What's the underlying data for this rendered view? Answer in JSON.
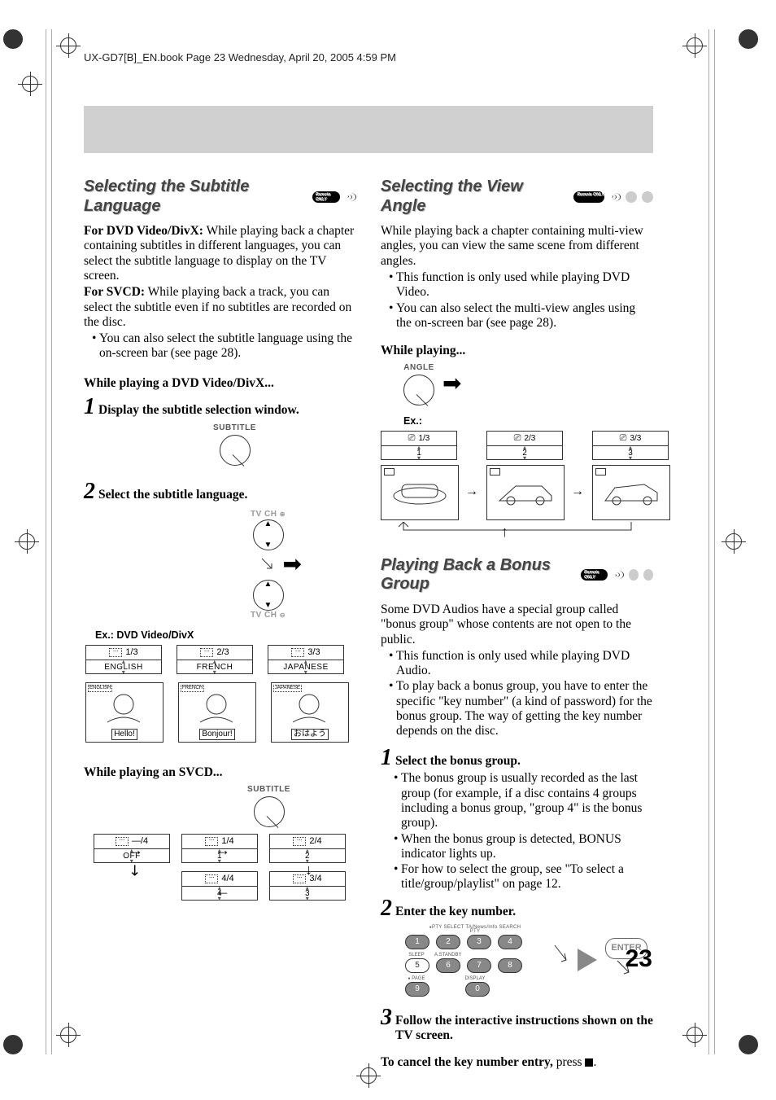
{
  "header": "UX-GD7[B]_EN.book  Page 23  Wednesday, April 20, 2005  4:59 PM",
  "page_number": "23",
  "left": {
    "title": "Selecting the Subtitle Language",
    "p1_bold": "For DVD Video/DivX:",
    "p1_rest": " While playing back a chapter containing subtitles in different languages, you can select the subtitle language to display on the TV screen.",
    "p2_bold": "For SVCD:",
    "p2_rest": " While playing back a track, you can select the subtitle even if no subtitles are recorded on the disc.",
    "bullet1": "You can also select the subtitle language using the on-screen bar (see page 28).",
    "while_dvd": "While playing a DVD Video/DivX...",
    "step1": "Display the subtitle selection window.",
    "subtitle_label": "SUBTITLE",
    "step2": "Select the subtitle language.",
    "tvch_up": "TV CH",
    "tvch_down": "TV CH",
    "ex_label": "Ex.: DVD Video/DivX",
    "lang": {
      "counts": [
        "1/3",
        "2/3",
        "3/3"
      ],
      "names": [
        "ENGLISH",
        "FRENCH",
        "JAPANESE"
      ],
      "captions": [
        "Hello!",
        "Bonjour!",
        "おはよう"
      ],
      "tiny": [
        "ENGLISH",
        "FRENCH",
        "JAPANESE"
      ]
    },
    "while_svcd": "While playing an SVCD...",
    "svcd_subtitle_label": "SUBTITLE",
    "svcd": {
      "counts_row1": [
        "—/4",
        "1/4",
        "2/4"
      ],
      "labels_row1": [
        "OFF",
        "1",
        "2"
      ],
      "counts_row2": [
        "4/4",
        "3/4"
      ],
      "labels_row2": [
        "4",
        "3"
      ]
    }
  },
  "right_angle": {
    "title": "Selecting the View Angle",
    "p1": "While playing back a chapter containing multi-view angles, you can view the same scene from different angles.",
    "bullet1": "This function is only used while playing DVD Video.",
    "bullet2": "You can also select the multi-view angles using the on-screen bar (see page 28).",
    "while": "While playing...",
    "angle_label": "ANGLE",
    "ex": "Ex.:",
    "counts": [
      "1/3",
      "2/3",
      "3/3"
    ],
    "nums": [
      "1",
      "2",
      "3"
    ]
  },
  "right_bonus": {
    "title": "Playing Back a Bonus Group",
    "p1": "Some DVD Audios have a special group called \"bonus group\" whose contents are not open to the public.",
    "bullet1": "This function is only used while playing DVD Audio.",
    "bullet2": "To play back a bonus group, you have to enter the specific \"key number\" (a kind of password) for the bonus group. The way of getting the key number depends on the disc.",
    "step1": "Select the bonus group.",
    "s1b1": "The bonus group is usually recorded as the last group (for example, if a disc contains 4 groups including a bonus group, \"group 4\" is the bonus group).",
    "s1b2": "When the bonus group is detected, BONUS indicator lights up.",
    "s1b3": "For how to select the group, see \"To select a title/group/playlist\" on page 12.",
    "step2": "Enter the key number.",
    "keypad_top_labels": "PTY SELECT   TA/News/Info SEARCH",
    "keypad_mid_labels_l": "SLEEP",
    "keypad_mid_labels_r": "A.STANDBY",
    "keypad_bot_labels_l": "PAGE",
    "keypad_bot_labels_r": "DISPLAY",
    "keys_r1": [
      "1",
      "2",
      "3",
      "4"
    ],
    "keys_r2": [
      "5",
      "6",
      "7",
      "8"
    ],
    "keys_r3": [
      "9",
      "0"
    ],
    "enter": "ENTER",
    "step3": "Follow the interactive instructions shown on the TV screen.",
    "cancel_bold": "To cancel the key number entry,",
    "cancel_rest": " press "
  },
  "pty_label": "PTY"
}
